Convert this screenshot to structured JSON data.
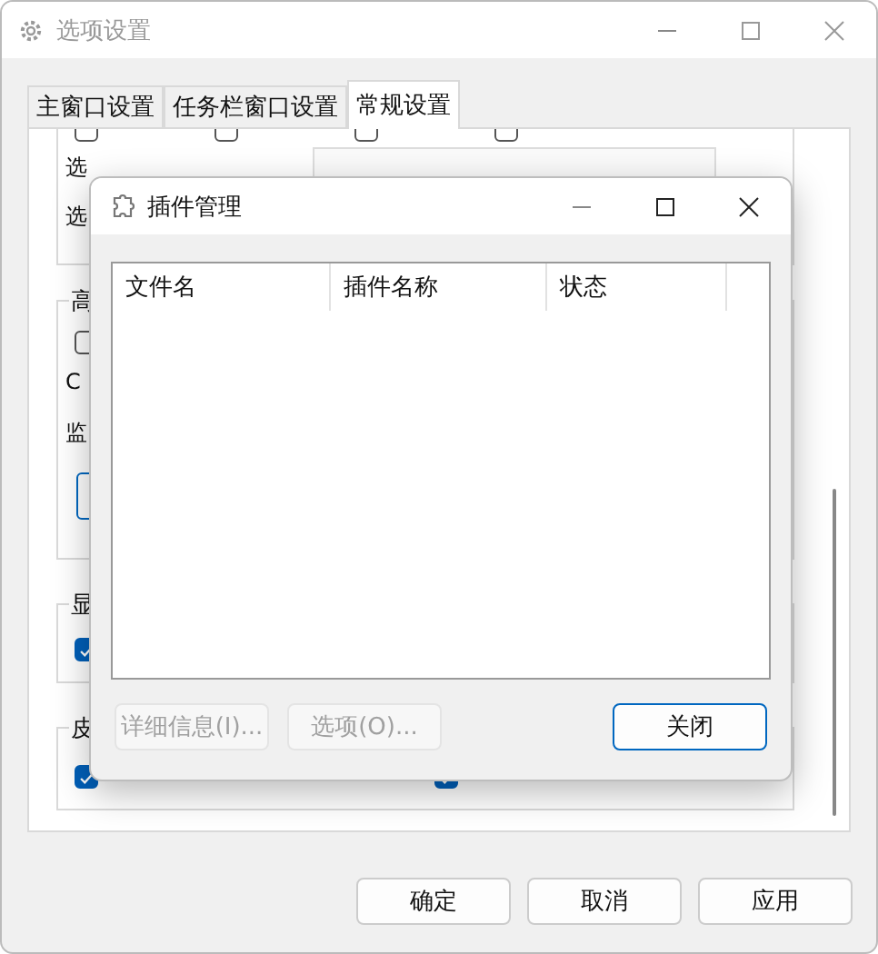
{
  "window": {
    "title": "选项设置"
  },
  "tabs": [
    {
      "label": "主窗口设置",
      "selected": false
    },
    {
      "label": "任务栏窗口设置",
      "selected": false
    },
    {
      "label": "常规设置",
      "selected": true
    }
  ],
  "hardware_checkboxes": [
    {
      "checked": false
    },
    {
      "checked": false
    },
    {
      "checked": false
    },
    {
      "checked": false
    }
  ],
  "section_1": {
    "rows": [
      {
        "label": "选"
      },
      {
        "label": "选"
      }
    ]
  },
  "section_2": {
    "title": "高",
    "checkbox": {
      "checked": false
    },
    "rows": [
      {
        "label": "C"
      },
      {
        "label": "监"
      }
    ]
  },
  "section_3": {
    "title": "显",
    "checkbox": {
      "checked": true
    }
  },
  "section_4": {
    "title": "皮",
    "checkboxes": [
      {
        "checked": true
      },
      {
        "checked": true
      }
    ]
  },
  "buttons": [
    {
      "label": "确定"
    },
    {
      "label": "取消"
    },
    {
      "label": "应用"
    }
  ],
  "dialog": {
    "title": "插件管理",
    "columns": [
      "文件名",
      "插件名称",
      "状态"
    ],
    "buttons": [
      {
        "label": "详细信息(I)...",
        "disabled": true,
        "default": false
      },
      {
        "label": "选项(O)...",
        "disabled": true,
        "default": false
      },
      {
        "label": "关闭",
        "disabled": false,
        "default": true
      }
    ]
  }
}
